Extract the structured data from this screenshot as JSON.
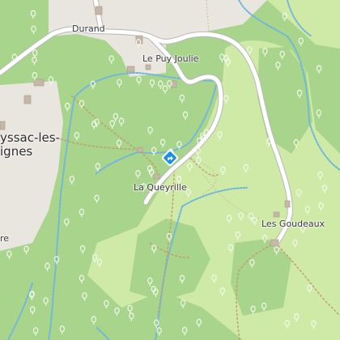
{
  "map": {
    "places": {
      "durand": "Durand",
      "le_puy_joulie": "Le Puy Joulie",
      "la_queyrille": "La Queyrille",
      "les_goudeaux": "Les Goudeaux"
    },
    "town_fragments": {
      "line1": "yssac-les-",
      "line2": "ignes",
      "edge": "re"
    },
    "marker": {
      "icon": "directions-diamond-icon",
      "color": "#1a8fe3"
    },
    "colors": {
      "forest": "#a8d48c",
      "meadow": "#cfeaa6",
      "built_area": "#e9e5df",
      "road": "#ffffff",
      "road_casing": "#b8b8b8",
      "path": "#c49a68",
      "stream": "#6fb6dc",
      "contour": "#c9b79a",
      "tree": "#f2f9ec"
    }
  }
}
